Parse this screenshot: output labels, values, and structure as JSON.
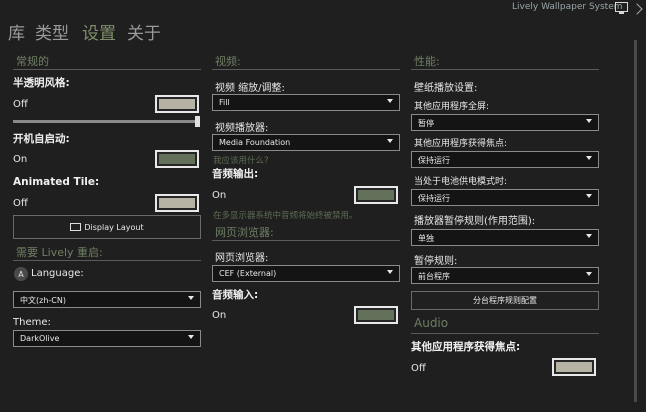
{
  "app": {
    "title": "Lively Wallpaper System"
  },
  "nav": [
    "库",
    "类型",
    "设置",
    "关于"
  ],
  "general": {
    "section": "常规的",
    "transparency": {
      "label": "半透明风格:",
      "value": "Off"
    },
    "startup": {
      "label": "开机自启动:",
      "value": "On"
    },
    "animated_tile": {
      "label": "Animated Tile:",
      "value": "Off"
    },
    "display_layout_button": "Display Layout",
    "restart_section": "需要 Lively 重启:",
    "language": {
      "label": "Language:",
      "value": "中文(zh-CN)"
    },
    "theme": {
      "label": "Theme:",
      "value": "DarkOlive"
    }
  },
  "video": {
    "section": "视频:",
    "scaling": {
      "label": "视频 缩放/调整:",
      "value": "Fill"
    },
    "player": {
      "label": "视频播放器:",
      "value": "Media Foundation"
    },
    "player_hint": "我应该用什么?",
    "audio_output": {
      "label": "音频输出:",
      "value": "On"
    },
    "audio_hint": "在多显示器系统中音频将始终被禁用。",
    "web_section": "网页浏览器:",
    "browser": {
      "label": "网页浏览器:",
      "value": "CEF (External)"
    },
    "audio_input": {
      "label": "音频输入:",
      "value": "On"
    }
  },
  "performance": {
    "section": "性能:",
    "playback_label": "壁纸播放设置:",
    "fullscreen": {
      "label": "其他应用程序全屏:",
      "value": "暂停"
    },
    "focus": {
      "label": "其他应用程序获得焦点:",
      "value": "保持运行"
    },
    "battery": {
      "label": "当处于电池供电模式时:",
      "value": "保持运行"
    },
    "pause_rule": {
      "label": "播放器暂停规则(作用范围):",
      "value": "单独"
    },
    "pause_rules": {
      "label": "暂停规则:",
      "value": "前台程序"
    },
    "rules_button": "分台程序规则配置",
    "audio_section": "Audio",
    "audio_focus": {
      "label": "其他应用程序获得焦点:",
      "value": "Off"
    }
  },
  "colors": {
    "accent": "#63705a",
    "section": "#6f7f63",
    "background": "#1f1f1f"
  }
}
